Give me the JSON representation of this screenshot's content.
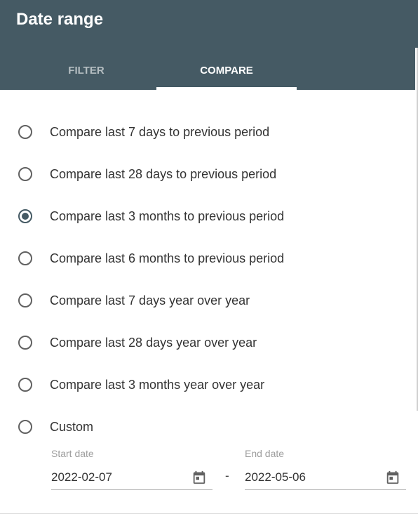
{
  "dialog": {
    "title": "Date range",
    "tabs": [
      {
        "label": "FILTER",
        "active": false
      },
      {
        "label": "COMPARE",
        "active": true
      }
    ]
  },
  "compare_options": [
    {
      "label": "Compare last 7 days to previous period",
      "selected": false
    },
    {
      "label": "Compare last 28 days to previous period",
      "selected": false
    },
    {
      "label": "Compare last 3 months to previous period",
      "selected": true
    },
    {
      "label": "Compare last 6 months to previous period",
      "selected": false
    },
    {
      "label": "Compare last 7 days year over year",
      "selected": false
    },
    {
      "label": "Compare last 28 days year over year",
      "selected": false
    },
    {
      "label": "Compare last 3 months year over year",
      "selected": false
    },
    {
      "label": "Custom",
      "selected": false
    }
  ],
  "custom_range": {
    "start": {
      "label": "Start date",
      "value": "2022-02-07"
    },
    "separator": "-",
    "end": {
      "label": "End date",
      "value": "2022-05-06"
    }
  },
  "colors": {
    "header_bg": "#455a64",
    "radio_selected": "#455a64"
  }
}
